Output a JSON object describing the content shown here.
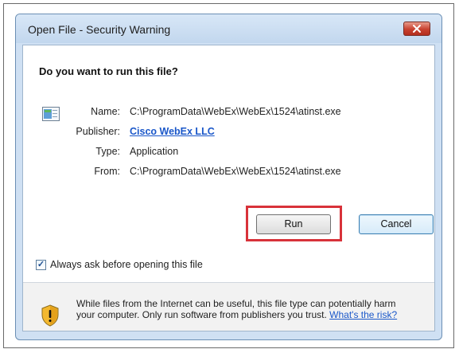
{
  "dialog": {
    "title": "Open File - Security Warning",
    "question": "Do you want to run this file?",
    "name_label": "Name:",
    "name_value": "C:\\ProgramData\\WebEx\\WebEx\\1524\\atinst.exe",
    "publisher_label": "Publisher:",
    "publisher_value": "Cisco WebEx LLC",
    "type_label": "Type:",
    "type_value": "Application",
    "from_label": "From:",
    "from_value": "C:\\ProgramData\\WebEx\\WebEx\\1524\\atinst.exe",
    "run_label": "Run",
    "cancel_label": "Cancel",
    "checkbox_label": "Always ask before opening this file",
    "checkbox_checked": "✓",
    "footer_text": "While files from the Internet can be useful, this file type can potentially harm your computer. Only run software from publishers you trust.",
    "footer_link": "What's the risk?",
    "close_icon": "×"
  },
  "colors": {
    "link": "#1a57c9",
    "highlight": "#d8323a",
    "close_button": "#c8412f"
  },
  "icons": {
    "close": "close-icon",
    "app": "application-icon",
    "shield": "security-shield-icon",
    "check": "checkmark-icon"
  }
}
